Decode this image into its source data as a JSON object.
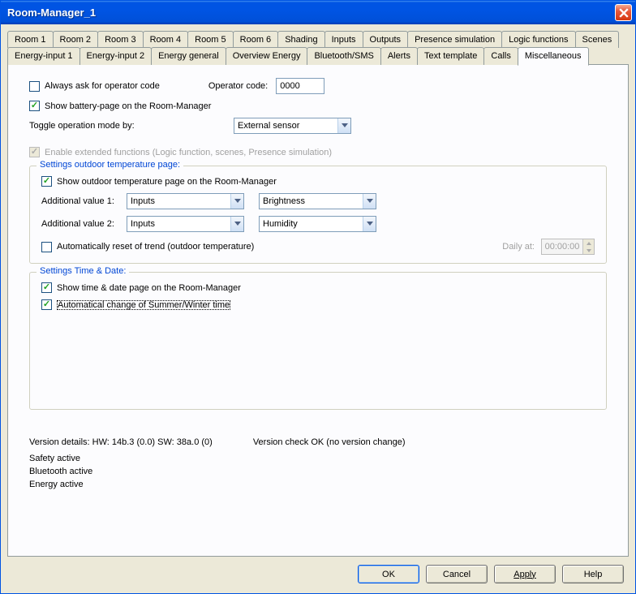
{
  "window": {
    "title": "Room-Manager_1"
  },
  "tabs_row1": [
    "Room 1",
    "Room 2",
    "Room 3",
    "Room 4",
    "Room 5",
    "Room 6",
    "Shading",
    "Inputs",
    "Outputs",
    "Presence simulation",
    "Logic functions",
    "Scenes"
  ],
  "tabs_row2": [
    "Energy-input 1",
    "Energy-input 2",
    "Energy general",
    "Overview Energy",
    "Bluetooth/SMS",
    "Alerts",
    "Text template",
    "Calls",
    "Miscellaneous"
  ],
  "selected_tab": "Miscellaneous",
  "misc": {
    "always_ask_label": "Always ask for operator code",
    "always_ask_checked": false,
    "operator_code_label": "Operator code:",
    "operator_code_value": "0000",
    "show_battery_label": "Show battery-page on the Room-Manager",
    "show_battery_checked": true,
    "toggle_mode_label": "Toggle operation mode by:",
    "toggle_mode_value": "External sensor",
    "enable_ext_label": "Enable extended functions (Logic function, scenes, Presence simulation)",
    "enable_ext_checked": true
  },
  "group_temp": {
    "title": "Settings outdoor temperature page:",
    "show_page_label": "Show outdoor temperature page on the Room-Manager",
    "show_page_checked": true,
    "add1_label": "Additional value 1:",
    "add1_src": "Inputs",
    "add1_val": "Brightness",
    "add2_label": "Additional value 2:",
    "add2_src": "Inputs",
    "add2_val": "Humidity",
    "auto_reset_label": "Automatically reset of trend (outdoor temperature)",
    "auto_reset_checked": false,
    "daily_at_label": "Daily at:",
    "daily_at_value": "00:00:00"
  },
  "group_time": {
    "title": "Settings Time & Date:",
    "show_td_label": "Show time & date page on the Room-Manager",
    "show_td_checked": true,
    "summer_label": "Automatical change of Summer/Winter time",
    "summer_checked": true
  },
  "footer": {
    "version_details": "Version details:   HW: 14b.3 (0.0)   SW: 38a.0 (0)",
    "version_check": "Version check OK (no version change)",
    "status_lines": [
      "Safety active",
      "Bluetooth active",
      "Energy active"
    ]
  },
  "buttons": {
    "ok": "OK",
    "cancel": "Cancel",
    "apply": "Apply",
    "help": "Help"
  }
}
